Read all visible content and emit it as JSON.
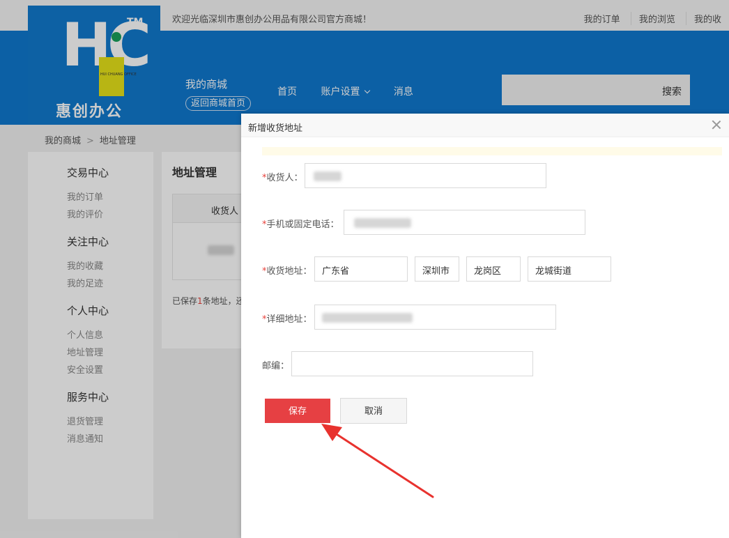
{
  "topbar": {
    "welcome": "欢迎光临深圳市惠创办公用品有限公司官方商城！",
    "links": [
      "我的订单",
      "我的浏览",
      "我的收"
    ]
  },
  "logo": {
    "letters": "HC",
    "tm": "TM",
    "sub_text": "HUI CHUANG OFFICE",
    "cn_name": "惠创办公"
  },
  "header": {
    "mall_title": "我的商城",
    "back_link": "返回商城首页",
    "nav": [
      "首页",
      "账户设置",
      "消息"
    ],
    "search_button": "搜索"
  },
  "breadcrumb": [
    "我的商城",
    "地址管理"
  ],
  "sidebar": {
    "groups": [
      {
        "title": "交易中心",
        "items": [
          "我的订单",
          "我的评价"
        ]
      },
      {
        "title": "关注中心",
        "items": [
          "我的收藏",
          "我的足迹"
        ]
      },
      {
        "title": "个人中心",
        "items": [
          "个人信息",
          "地址管理",
          "安全设置"
        ]
      },
      {
        "title": "服务中心",
        "items": [
          "退货管理",
          "消息通知"
        ]
      }
    ]
  },
  "panel": {
    "title": "地址管理",
    "column_header": "收货人",
    "note_prefix": "已保存",
    "note_count": "1",
    "note_suffix": "条地址，还"
  },
  "modal": {
    "title": "新增收货地址",
    "fields": {
      "receiver_label": "收货人：",
      "phone_label": "手机或固定电话：",
      "address_label": "收货地址：",
      "province": "广东省",
      "city": "深圳市",
      "district": "龙岗区",
      "street": "龙城街道",
      "detail_label": "详细地址：",
      "postcode_label": "邮编："
    },
    "required_mark": "*",
    "save_label": "保存",
    "cancel_label": "取消"
  },
  "colors": {
    "header_blue": "#0f78cf",
    "save_red": "#e64043",
    "required_red": "#e8413b",
    "annotation_arrow": "#e8322e"
  }
}
